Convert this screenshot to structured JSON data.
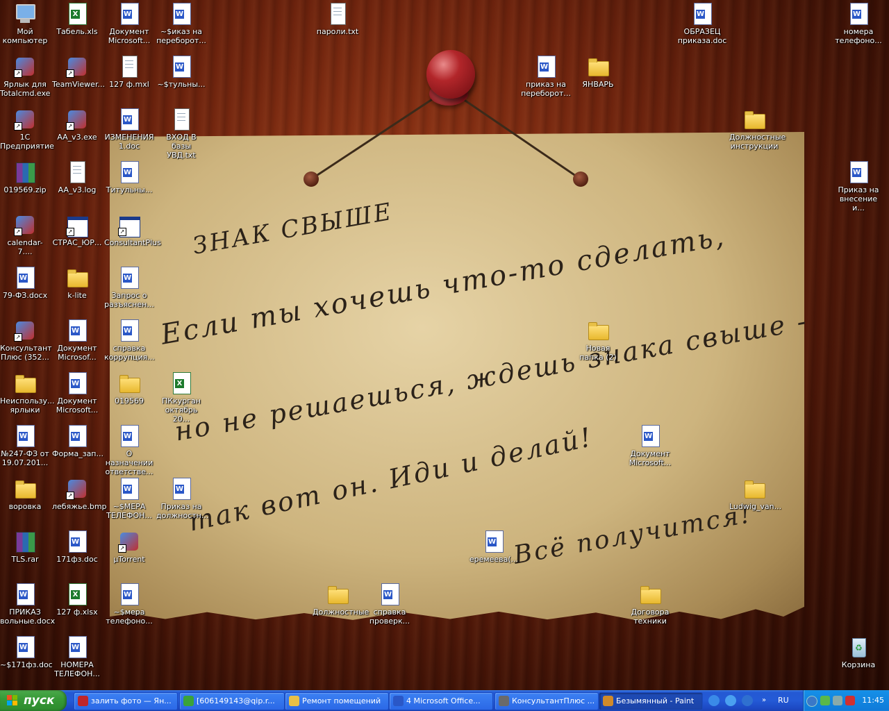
{
  "note": {
    "title": "ЗНАК СВЫШЕ",
    "lines": [
      "Если ты хочешь что-то сделать,",
      "но не решаешься, ждешь  знака свыше -",
      "так вот он. Иди и делай!",
      "Всё получится!"
    ]
  },
  "icons": [
    {
      "label": "Мой компьютер",
      "type": "computer"
    },
    {
      "label": "Табель.xls",
      "type": "xls"
    },
    {
      "label": "Документ Microsoft...",
      "type": "doc"
    },
    {
      "label": "~$иказ на переборот...",
      "type": "doc"
    },
    {
      "label": "пароли.txt",
      "type": "txt"
    },
    {
      "label": "ОБРАЗЕЦ приказа.doc",
      "type": "doc"
    },
    {
      "label": "номера телефоно...",
      "type": "doc"
    },
    {
      "label": "Ярлык для Totalcmd.exe",
      "type": "app"
    },
    {
      "label": "TeamViewer...",
      "type": "app"
    },
    {
      "label": "127 ф.mxl",
      "type": "txt"
    },
    {
      "label": "~$тульны...",
      "type": "doc"
    },
    {
      "label": "приказ на переборот...",
      "type": "doc"
    },
    {
      "label": "ЯНВАРЬ",
      "type": "folder"
    },
    {
      "label": "1С Предприятие",
      "type": "app"
    },
    {
      "label": "AA_v3.exe",
      "type": "app"
    },
    {
      "label": "ИЗМЕНЕНИЯ 1.doc",
      "type": "doc"
    },
    {
      "label": "ВХОД В базы УВД.txt",
      "type": "txt"
    },
    {
      "label": "Должностные инструкции",
      "type": "folder"
    },
    {
      "label": "019569.zip",
      "type": "archive"
    },
    {
      "label": "AA_v3.log",
      "type": "txt"
    },
    {
      "label": "Титульны...",
      "type": "doc"
    },
    {
      "label": "Приказ на внесение и...",
      "type": "doc"
    },
    {
      "label": "calendar-7....",
      "type": "app"
    },
    {
      "label": "СТРАС_ЮР...",
      "type": "window"
    },
    {
      "label": "ConsultantPlus",
      "type": "window"
    },
    {
      "label": "79-ФЗ.docx",
      "type": "doc"
    },
    {
      "label": "k-lite",
      "type": "folder"
    },
    {
      "label": "Запрос о разъяснен...",
      "type": "doc"
    },
    {
      "label": "Консультант Плюс (352...",
      "type": "app"
    },
    {
      "label": "Документ Microsof...",
      "type": "doc"
    },
    {
      "label": "справка коррупция...",
      "type": "doc"
    },
    {
      "label": "Новая папка (2)",
      "type": "folder"
    },
    {
      "label": "Неиспользу... ярлыки",
      "type": "folder"
    },
    {
      "label": "Документ Microsoft...",
      "type": "doc"
    },
    {
      "label": "019569",
      "type": "folder"
    },
    {
      "label": "ПКкурган октябрь 20...",
      "type": "xls"
    },
    {
      "label": "№247-ФЗ от 19.07.201...",
      "type": "doc"
    },
    {
      "label": "Форма_зап...",
      "type": "doc"
    },
    {
      "label": "О назначении ответстве...",
      "type": "doc"
    },
    {
      "label": "Документ Microsoft...",
      "type": "doc"
    },
    {
      "label": "воровка",
      "type": "folder"
    },
    {
      "label": "лебяжье.bmp",
      "type": "app"
    },
    {
      "label": "~$МЕРА ТЕЛЕФОН...",
      "type": "doc"
    },
    {
      "label": "Приказ на должностн...",
      "type": "doc"
    },
    {
      "label": "Ludwig_van...",
      "type": "folder"
    },
    {
      "label": "TLS.rar",
      "type": "archive"
    },
    {
      "label": "171фз.doc",
      "type": "doc"
    },
    {
      "label": "µTorrent",
      "type": "app"
    },
    {
      "label": "еремеева(...",
      "type": "doc"
    },
    {
      "label": "ПРИКАЗ вольные.docx",
      "type": "doc"
    },
    {
      "label": "127 ф.xlsx",
      "type": "xls"
    },
    {
      "label": "~$мера телефоно...",
      "type": "doc"
    },
    {
      "label": "Должностные",
      "type": "folder"
    },
    {
      "label": "справка проверк...",
      "type": "doc"
    },
    {
      "label": "Договора техники",
      "type": "folder"
    },
    {
      "label": "~$171фз.doc",
      "type": "doc"
    },
    {
      "label": "НОМЕРА ТЕЛЕФОН...",
      "type": "doc"
    },
    {
      "label": "Корзина",
      "type": "recycle"
    }
  ],
  "taskbar": {
    "start_label": "пуск",
    "tasks": [
      {
        "label": "залить фото — Ян...",
        "color": "#c0262a"
      },
      {
        "label": "[606149143@qip.r...",
        "color": "#3aa33a"
      },
      {
        "label": "Ремонт помещений",
        "color": "#e8c047"
      },
      {
        "label": "4 Microsoft Office...",
        "color": "#2a57c7"
      },
      {
        "label": "КонсультантПлюс ...",
        "color": "#6a6a6a"
      },
      {
        "label": "Безымянный - Paint",
        "color": "#d08a2a"
      }
    ],
    "language": "RU",
    "clock": "11:45"
  },
  "colors": {
    "taskbar": "#245ad6",
    "start": "#379a37",
    "tray": "#0f7ad8"
  }
}
